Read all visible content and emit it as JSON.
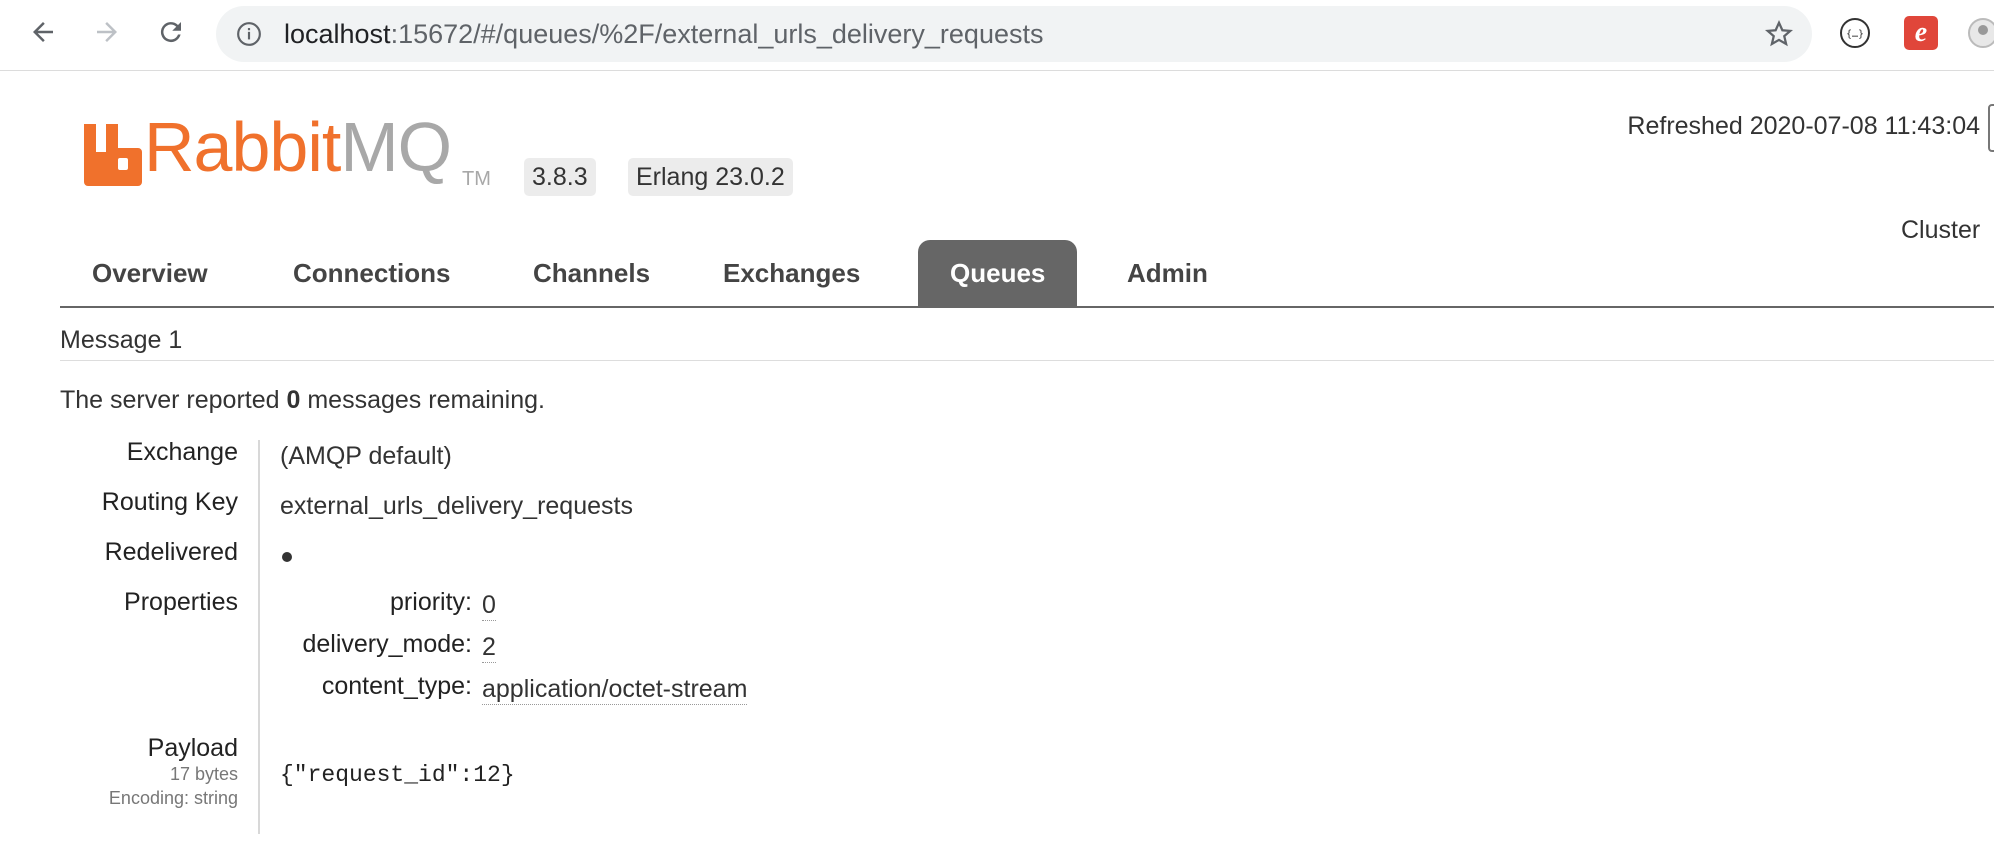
{
  "browser": {
    "url_host": "localhost",
    "url_rest": ":15672/#/queues/%2F/external_urls_delivery_requests",
    "extension_label": "e"
  },
  "header": {
    "logo_rabbit": "Rabbit",
    "logo_mq": "MQ",
    "logo_tm": "TM",
    "version": "3.8.3",
    "erlang": "Erlang 23.0.2",
    "refreshed": "Refreshed 2020-07-08 11:43:04",
    "cluster": "Cluster"
  },
  "tabs": [
    {
      "label": "Overview",
      "active": false
    },
    {
      "label": "Connections",
      "active": false
    },
    {
      "label": "Channels",
      "active": false
    },
    {
      "label": "Exchanges",
      "active": false
    },
    {
      "label": "Queues",
      "active": true
    },
    {
      "label": "Admin",
      "active": false
    }
  ],
  "message": {
    "title": "Message 1",
    "remaining_prefix": "The server reported",
    "remaining_count": "0",
    "remaining_suffix": "messages remaining.",
    "fields": {
      "exchange_label": "Exchange",
      "exchange_value": "(AMQP default)",
      "routing_key_label": "Routing Key",
      "routing_key_value": "external_urls_delivery_requests",
      "redelivered_label": "Redelivered",
      "properties_label": "Properties"
    },
    "properties": [
      {
        "key": "priority:",
        "value": "0"
      },
      {
        "key": "delivery_mode:",
        "value": "2"
      },
      {
        "key": "content_type:",
        "value": "application/octet-stream"
      }
    ],
    "payload": {
      "label": "Payload",
      "size": "17 bytes",
      "encoding": "Encoding: string",
      "content": "{\"request_id\":12}"
    }
  },
  "colors": {
    "brand_orange": "#f0712c",
    "brand_grey": "#a8a8a8",
    "active_tab": "#666666"
  }
}
